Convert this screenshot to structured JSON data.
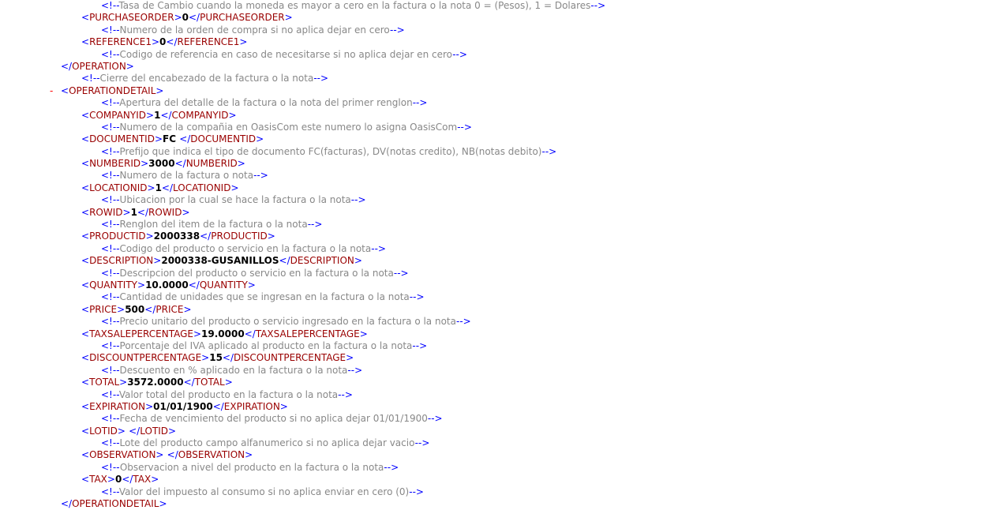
{
  "colors": {
    "markup": "#0000ff",
    "tag_name": "#990000",
    "comment": "#888888",
    "value": "#000000",
    "collapse_marker": "#ff0000",
    "background": "#ffffff"
  },
  "collapse_marker": "-",
  "lines": [
    {
      "type": "comment",
      "level": 2,
      "text": "Tasa de Cambio cuando la moneda es mayor a cero en la factura o la nota 0 = (Pesos), 1 = Dolares"
    },
    {
      "type": "element",
      "level": 1,
      "name": "PURCHASEORDER",
      "value": "0"
    },
    {
      "type": "comment",
      "level": 2,
      "text": "Numero de la orden de compra si no aplica dejar en cero"
    },
    {
      "type": "element",
      "level": 1,
      "name": "REFERENCE1",
      "value": "0"
    },
    {
      "type": "comment",
      "level": 2,
      "text": "Codigo de referencia en caso de necesitarse si no aplica dejar en cero"
    },
    {
      "type": "close",
      "level": 0,
      "name": "OPERATION"
    },
    {
      "type": "comment",
      "level": 1,
      "text": "Cierre del encabezado de la factura o la nota"
    },
    {
      "type": "open",
      "level": 0,
      "name": "OPERATIONDETAIL",
      "collapsible": true
    },
    {
      "type": "comment",
      "level": 2,
      "text": "Apertura del detalle de la factura o la nota del primer renglon"
    },
    {
      "type": "element",
      "level": 1,
      "name": "COMPANYID",
      "value": "1"
    },
    {
      "type": "comment",
      "level": 2,
      "text": "Numero de la compañia en OasisCom este numero lo asigna OasisCom"
    },
    {
      "type": "element",
      "level": 1,
      "name": "DOCUMENTID",
      "value": "FC "
    },
    {
      "type": "comment",
      "level": 2,
      "text": "Prefijo que indica el tipo de documento FC(facturas), DV(notas credito), NB(notas debito)"
    },
    {
      "type": "element",
      "level": 1,
      "name": "NUMBERID",
      "value": "3000"
    },
    {
      "type": "comment",
      "level": 2,
      "text": "Numero de la factura o nota"
    },
    {
      "type": "element",
      "level": 1,
      "name": "LOCATIONID",
      "value": "1"
    },
    {
      "type": "comment",
      "level": 2,
      "text": "Ubicacion por la cual se hace la factura o la nota"
    },
    {
      "type": "element",
      "level": 1,
      "name": "ROWID",
      "value": "1"
    },
    {
      "type": "comment",
      "level": 2,
      "text": "Renglon del item de la factura o la nota"
    },
    {
      "type": "element",
      "level": 1,
      "name": "PRODUCTID",
      "value": "2000338"
    },
    {
      "type": "comment",
      "level": 2,
      "text": "Codigo del producto o servicio en la factura o la nota"
    },
    {
      "type": "element",
      "level": 1,
      "name": "DESCRIPTION",
      "value": "2000338-GUSANILLOS"
    },
    {
      "type": "comment",
      "level": 2,
      "text": "Descripcion del producto o servicio en la factura o la nota"
    },
    {
      "type": "element",
      "level": 1,
      "name": "QUANTITY",
      "value": "10.0000"
    },
    {
      "type": "comment",
      "level": 2,
      "text": "Cantidad de unidades que se ingresan en la factura o la nota"
    },
    {
      "type": "element",
      "level": 1,
      "name": "PRICE",
      "value": "500"
    },
    {
      "type": "comment",
      "level": 2,
      "text": "Precio unitario del producto o servicio ingresado en la factura o la nota"
    },
    {
      "type": "element",
      "level": 1,
      "name": "TAXSALEPERCENTAGE",
      "value": "19.0000"
    },
    {
      "type": "comment",
      "level": 2,
      "text": "Porcentaje del IVA aplicado al producto en la factura o la nota"
    },
    {
      "type": "element",
      "level": 1,
      "name": "DISCOUNTPERCENTAGE",
      "value": "15"
    },
    {
      "type": "comment",
      "level": 2,
      "text": "Descuento en % aplicado en la factura o la nota"
    },
    {
      "type": "element",
      "level": 1,
      "name": "TOTAL",
      "value": "3572.0000"
    },
    {
      "type": "comment",
      "level": 2,
      "text": "Valor total del producto en la factura o la nota"
    },
    {
      "type": "element",
      "level": 1,
      "name": "EXPIRATION",
      "value": "01/01/1900"
    },
    {
      "type": "comment",
      "level": 2,
      "text": "Fecha de vencimiento del producto si no aplica dejar 01/01/1900"
    },
    {
      "type": "element",
      "level": 1,
      "name": "LOTID",
      "value": " "
    },
    {
      "type": "comment",
      "level": 2,
      "text": "Lote del producto campo alfanumerico si no aplica dejar vacio"
    },
    {
      "type": "element",
      "level": 1,
      "name": "OBSERVATION",
      "value": " "
    },
    {
      "type": "comment",
      "level": 2,
      "text": "Observacion a nivel del producto en la factura o la nota"
    },
    {
      "type": "element",
      "level": 1,
      "name": "TAX",
      "value": "0"
    },
    {
      "type": "comment",
      "level": 2,
      "text": "Valor del impuesto al consumo si no aplica enviar en cero (0)"
    },
    {
      "type": "close",
      "level": 0,
      "name": "OPERATIONDETAIL"
    }
  ]
}
